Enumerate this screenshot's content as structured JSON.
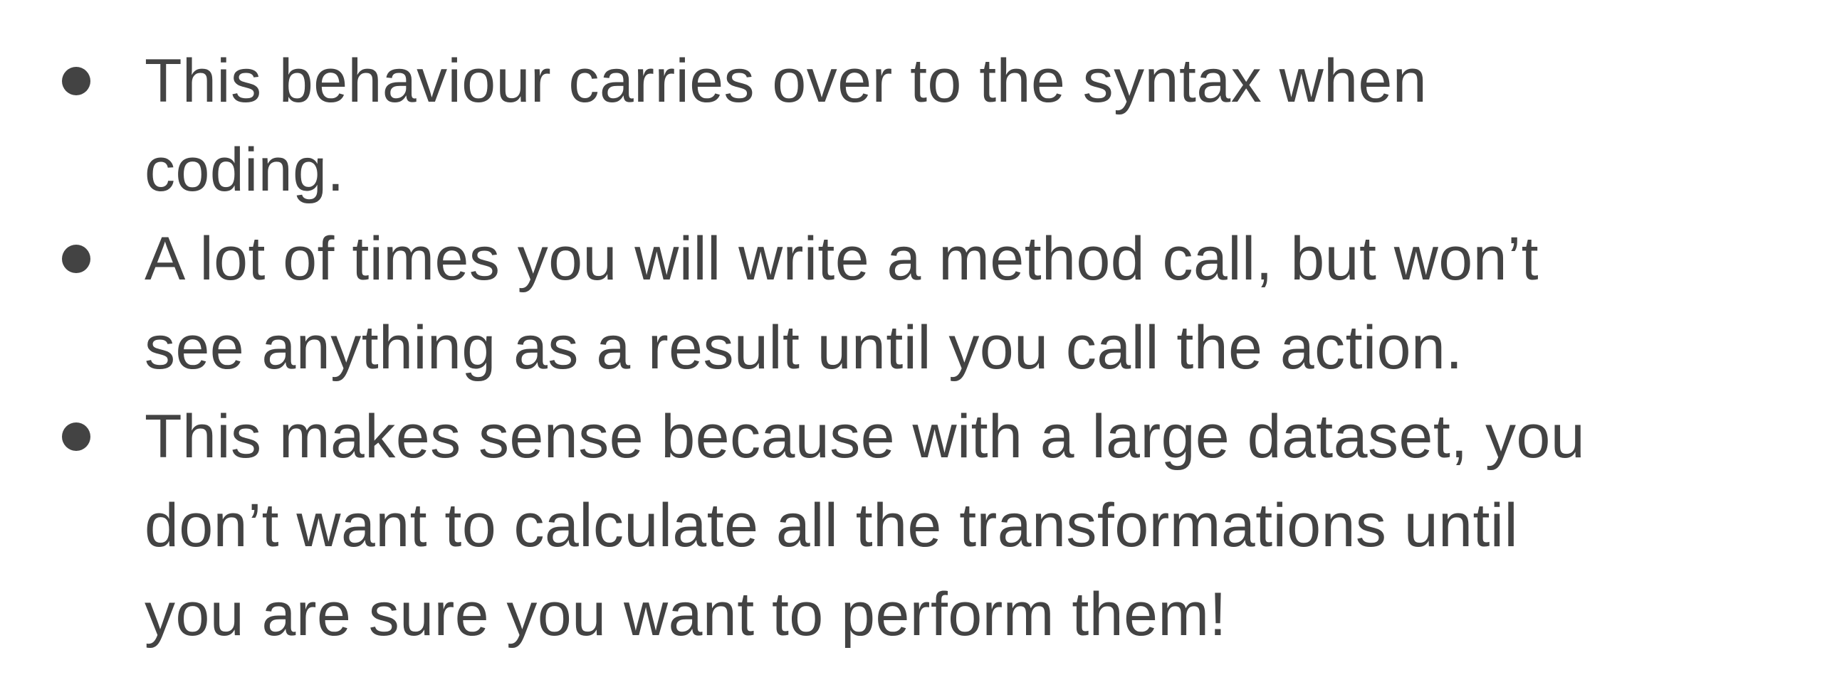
{
  "bullets": [
    {
      "text": "This behaviour carries over to the syntax when\ncoding."
    },
    {
      "text": "A lot of times you will write a method call, but won’t\nsee anything as a result until you call the action."
    },
    {
      "text": "This makes sense because with a large dataset, you\ndon’t want to calculate all the transformations until\nyou are sure you want to perform them!"
    }
  ]
}
